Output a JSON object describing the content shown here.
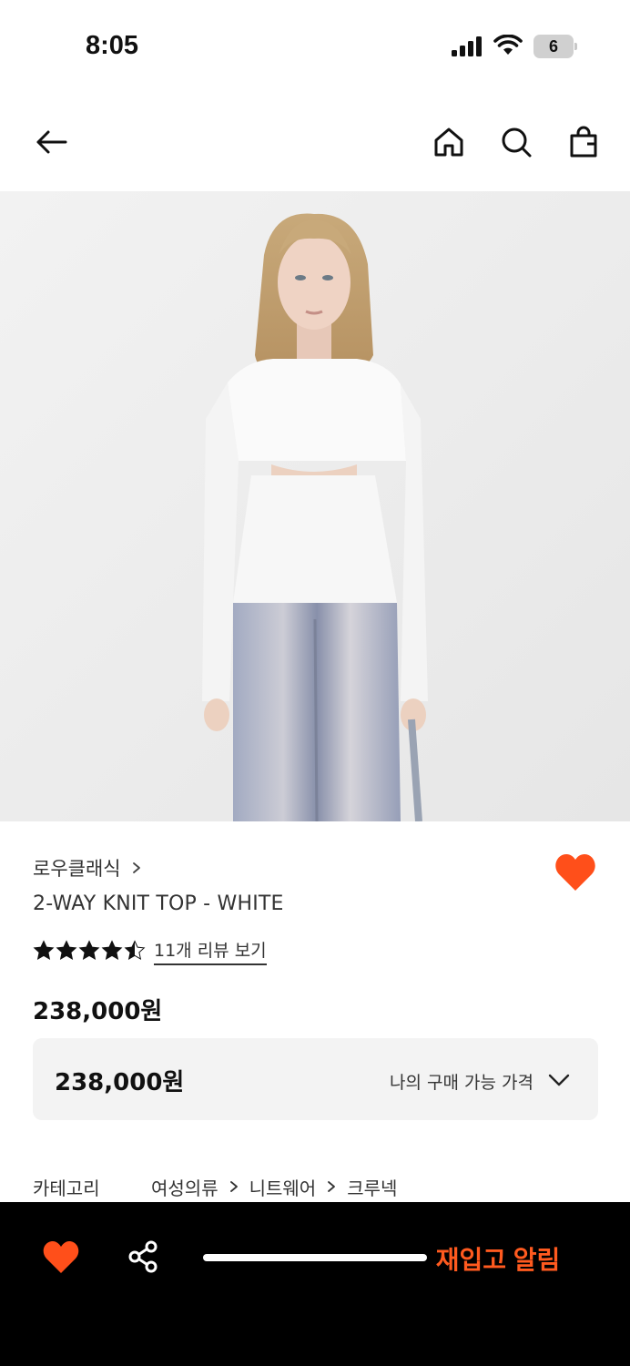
{
  "status_bar": {
    "time": "8:05",
    "battery_level": "6",
    "icons": [
      "signal-icon",
      "wifi-icon",
      "battery-icon"
    ]
  },
  "nav": {
    "icons": [
      "back-arrow-icon",
      "home-icon",
      "search-icon",
      "shopping-bag-icon"
    ]
  },
  "product": {
    "image_alt": "model wearing white ribbed knit top with cutout",
    "brand": "로우클래식",
    "name": "2-WAY KNIT TOP - WHITE",
    "rating": 4.5,
    "rating_max": 5,
    "review_link": "11개 리뷰 보기",
    "price": "238,000원",
    "wishlisted": true
  },
  "price_box": {
    "price": "238,000원",
    "label": "나의 구매 가능 가격"
  },
  "category": {
    "label": "카테고리",
    "path": [
      "여성의류",
      "니트웨어",
      "크루넥"
    ]
  },
  "bottom_bar": {
    "restock_label": "재입고 알림"
  },
  "colors": {
    "accent": "#ff4f1a",
    "bottom_bar_bg": "#000000",
    "price_box_bg": "#f3f3f3"
  }
}
